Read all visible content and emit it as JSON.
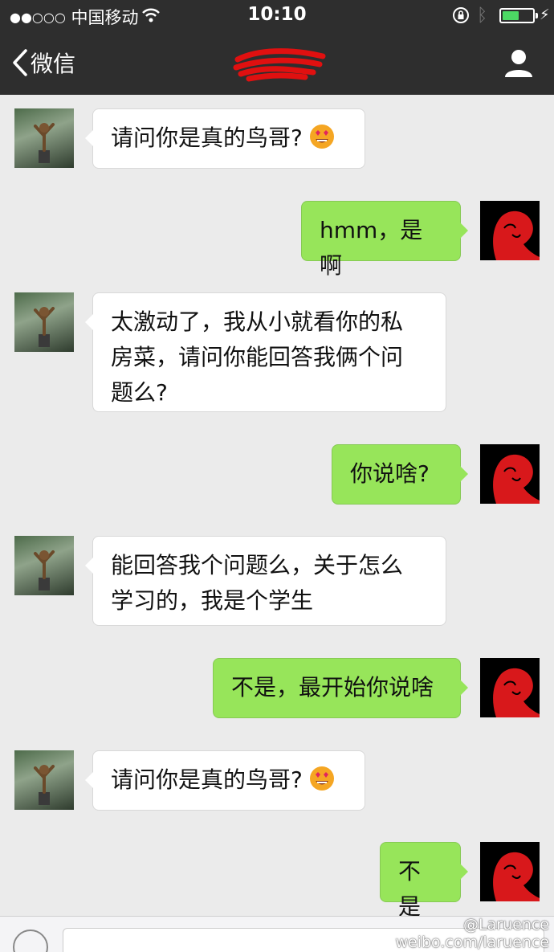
{
  "status_bar": {
    "signal": "●●○○○",
    "carrier": "中国移动",
    "time": "10:10"
  },
  "nav": {
    "back_label": "微信",
    "title_redacted": true
  },
  "messages": [
    {
      "side": "left",
      "text": "请问你是真的鸟哥?",
      "emoji": "heart-eyes-emoji"
    },
    {
      "side": "right",
      "text": "hmm，是啊"
    },
    {
      "side": "left",
      "lines": [
        "太激动了，我从小就看你的私",
        "房菜，请问你能回答我俩个问",
        "题么?"
      ]
    },
    {
      "side": "right",
      "text": "你说啥?"
    },
    {
      "side": "left",
      "lines": [
        "能回答我个问题么，关于怎么",
        "学习的，我是个学生"
      ]
    },
    {
      "side": "right",
      "text": "不是，最开始你说啥"
    },
    {
      "side": "left",
      "text": "请问你是真的鸟哥?",
      "emoji": "heart-eyes-emoji"
    },
    {
      "side": "right",
      "text": "不是"
    }
  ],
  "watermark": {
    "handle": "@Laruence",
    "url": "weibo.com/laruence"
  },
  "colors": {
    "nav_bg": "#2e2e2e",
    "chat_bg": "#ebebeb",
    "my_bubble": "#97e55a",
    "their_bubble": "#ffffff"
  }
}
